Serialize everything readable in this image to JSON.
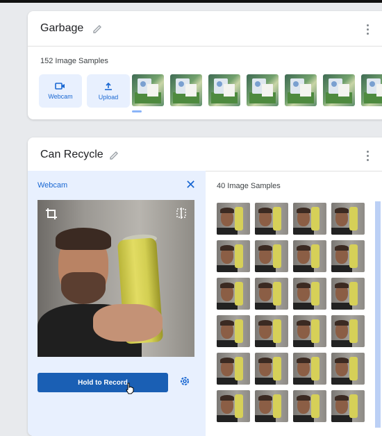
{
  "garbage": {
    "title": "Garbage",
    "samples_count_label": "152 Image Samples",
    "webcam_label": "Webcam",
    "upload_label": "Upload",
    "thumb_count": 7
  },
  "can_recycle": {
    "title": "Can Recycle",
    "webcam_panel": {
      "title": "Webcam",
      "record_label": "Hold to Record"
    },
    "samples_count_label": "40 Image Samples",
    "grid_columns": 4,
    "grid_rows": 6
  },
  "colors": {
    "accent": "#1967d2",
    "record_button": "#1a5fb4",
    "panel_bg": "#e8f0fe"
  },
  "icons": [
    "pencil-icon",
    "kebab-menu-icon",
    "webcam-icon",
    "upload-icon",
    "close-icon",
    "crop-icon",
    "flip-icon",
    "settings-gear-icon",
    "hand-cursor-icon"
  ]
}
